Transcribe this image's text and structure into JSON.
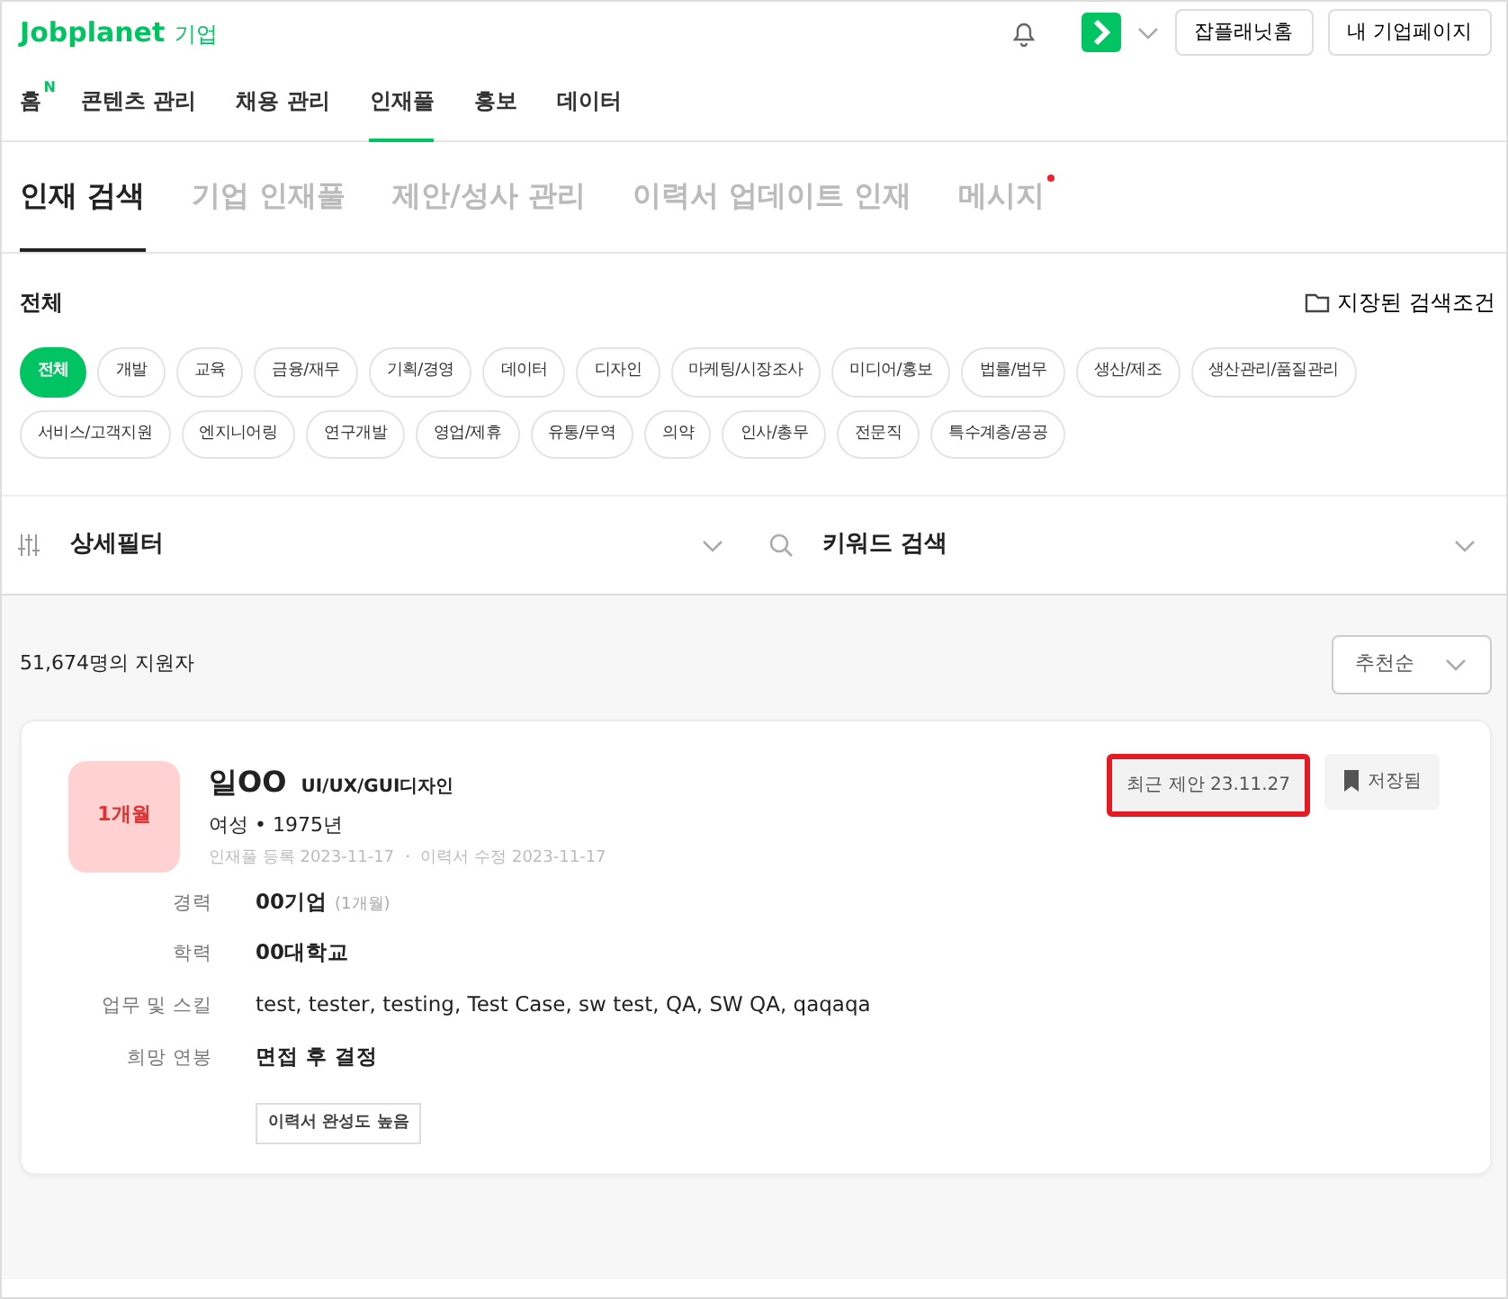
{
  "header": {
    "logo": "Jobplanet",
    "logo_suffix": "기업",
    "buttons": [
      "잡플래닛홈",
      "내 기업페이지"
    ]
  },
  "nav": [
    {
      "label": "홈",
      "badge": "N",
      "selected": false
    },
    {
      "label": "콘텐츠 관리",
      "selected": false
    },
    {
      "label": "채용 관리",
      "selected": false
    },
    {
      "label": "인재풀",
      "selected": true
    },
    {
      "label": "홍보",
      "selected": false
    },
    {
      "label": "데이터",
      "selected": false
    }
  ],
  "subtabs": [
    {
      "label": "인재 검색",
      "selected": true,
      "dot": false
    },
    {
      "label": "기업 인재풀",
      "selected": false,
      "dot": false
    },
    {
      "label": "제안/성사 관리",
      "selected": false,
      "dot": false
    },
    {
      "label": "이력서 업데이트 인재",
      "selected": false,
      "dot": false
    },
    {
      "label": "메시지",
      "selected": false,
      "dot": true
    }
  ],
  "category_title": "전체",
  "saved_search": "지장된 검색조건",
  "categories": [
    {
      "label": "전체",
      "selected": true
    },
    {
      "label": "개발",
      "selected": false
    },
    {
      "label": "교육",
      "selected": false
    },
    {
      "label": "금융/재무",
      "selected": false
    },
    {
      "label": "기획/경영",
      "selected": false
    },
    {
      "label": "데이터",
      "selected": false
    },
    {
      "label": "디자인",
      "selected": false
    },
    {
      "label": "마케팅/시장조사",
      "selected": false
    },
    {
      "label": "미디어/홍보",
      "selected": false
    },
    {
      "label": "법률/법무",
      "selected": false
    },
    {
      "label": "생산/제조",
      "selected": false
    },
    {
      "label": "생산관리/품질관리",
      "selected": false
    },
    {
      "label": "서비스/고객지원",
      "selected": false
    },
    {
      "label": "엔지니어링",
      "selected": false
    },
    {
      "label": "연구개발",
      "selected": false
    },
    {
      "label": "영업/제휴",
      "selected": false
    },
    {
      "label": "유통/무역",
      "selected": false
    },
    {
      "label": "의약",
      "selected": false
    },
    {
      "label": "인사/총무",
      "selected": false
    },
    {
      "label": "전문직",
      "selected": false
    },
    {
      "label": "특수계층/공공",
      "selected": false
    }
  ],
  "filters": {
    "detail": "상세필터",
    "keyword": "키워드 검색"
  },
  "result_count": "51,674명의 지원자",
  "sort": "추천순",
  "candidate": {
    "tag": "1개월",
    "name": "일OO",
    "job": "UI/UX/GUI디자인",
    "profile": "여성 • 1975년",
    "dates": "인재풀 등록 2023-11-17 ・ 이력서 수정 2023-11-17",
    "recent_offer": {
      "label": "최근 제안 23.11.27",
      "highlighted": true
    },
    "save": {
      "label": "저장됨",
      "saved": true
    },
    "fields": [
      {
        "label": "경력",
        "value": "00기업",
        "note": "(1개월)",
        "bold": true
      },
      {
        "label": "학력",
        "value": "00대학교",
        "bold": true
      },
      {
        "label": "업무 및 스킬",
        "value": "test, tester, testing, Test Case, sw test, QA, SW QA, qaqaqa",
        "bold": false
      },
      {
        "label": "희망 연봉",
        "value": "면접 후 결정",
        "bold": true
      }
    ],
    "badge": "이력서 완성도 높음"
  }
}
